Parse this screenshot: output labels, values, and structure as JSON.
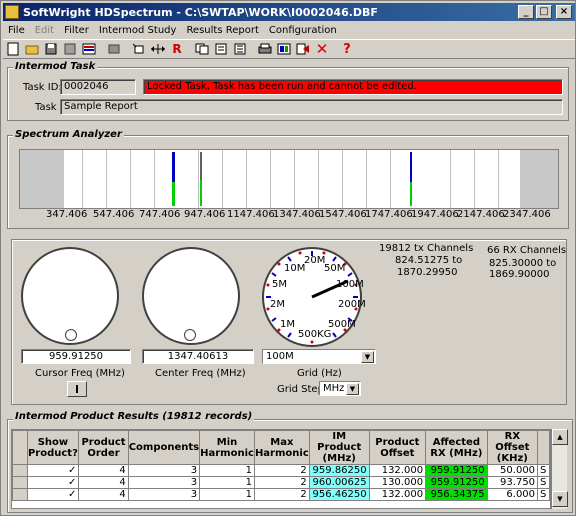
{
  "window": {
    "title": "SoftWright HDSpectrum - C:\\SWTAP\\WORK\\I0002046.DBF",
    "buttons": {
      "minimize": "_",
      "maximize": "□",
      "close": "×"
    }
  },
  "menu": [
    "File",
    "Edit",
    "Filter",
    "Intermod Study",
    "Results Report",
    "Configuration"
  ],
  "toolbar": [
    "new-icon",
    "open-icon",
    "save-icon",
    "print-preview-icon",
    "chart-icon",
    "settings-icon",
    "zoom-icon",
    "width-icon",
    "r-icon",
    "sep",
    "copy-icon",
    "report-icon",
    "list-icon",
    "sep",
    "printer-icon",
    "filter-icon",
    "export-icon",
    "delete-icon",
    "help-icon"
  ],
  "toolbar_glyphs": {
    "r-icon": "R",
    "delete-icon": "✕",
    "help-icon": "?"
  },
  "intermod_task": {
    "title": "Intermod Task",
    "task_id_label": "Task ID:",
    "task_id": "0002046",
    "locked_message": "Locked Task, Task has been run and cannot be edited.",
    "task_label": "Task",
    "task_name": "Sample Report"
  },
  "spectrum": {
    "title": "Spectrum Analyzer",
    "ticks": [
      "347.406",
      "547.406",
      "747.406",
      "947.406",
      "1147.406",
      "1347.406",
      "1547.406",
      "1747.406",
      "1947.406",
      "2147.406",
      "2347.406"
    ]
  },
  "controls": {
    "tx_channels": "19812 tx Channels",
    "tx_range_low": "824.51275 to",
    "tx_range_high": "1870.29950",
    "rx_channels": "66 RX Channels",
    "rx_range_low": "825.30000 to",
    "rx_range_high": "1869.90000",
    "cursor_freq_value": "959.91250",
    "cursor_freq_label": "Cursor Freq (MHz)",
    "center_freq_value": "1347.40613",
    "center_freq_label": "Center Freq (MHz)",
    "grid_value": "100M",
    "grid_label": "Grid (Hz)",
    "grid_step_label": "Grid Step",
    "grid_step_value": "MHz",
    "dial_labels": {
      "top": "20M",
      "top_left": "10M",
      "left_upper": "5M",
      "left_lower": "2M",
      "bottom_left": "1M",
      "bottom": "500KG",
      "bottom_right": "500M",
      "right_lower": "200M",
      "right_upper": "100M",
      "top_right": "50M"
    }
  },
  "results": {
    "title": "Intermod Product Results (19812 records)",
    "columns": [
      "Show Product?",
      "Product Order",
      "Components",
      "Min Harmonic",
      "Max Harmonic",
      "IM Product (MHz)",
      "Product Offset",
      "Affected RX (MHz)",
      "RX Offset (KHz)",
      ""
    ],
    "rows": [
      [
        "✓",
        "4",
        "3",
        "1",
        "2",
        "959.86250",
        "132.000",
        "959.91250",
        "50.000",
        "S"
      ],
      [
        "✓",
        "4",
        "3",
        "1",
        "2",
        "960.00625",
        "130.000",
        "959.91250",
        "93.750",
        "S"
      ],
      [
        "✓",
        "4",
        "3",
        "1",
        "2",
        "956.46250",
        "132.000",
        "956.34375",
        "6.000",
        "S"
      ]
    ]
  },
  "colors": {
    "titlebar": "#0a246a",
    "locked": "#ff0000",
    "im_product": "#80ffff",
    "affected_rx": "#00e000",
    "marker_blue": "#0000c0",
    "marker_green": "#00d000"
  }
}
